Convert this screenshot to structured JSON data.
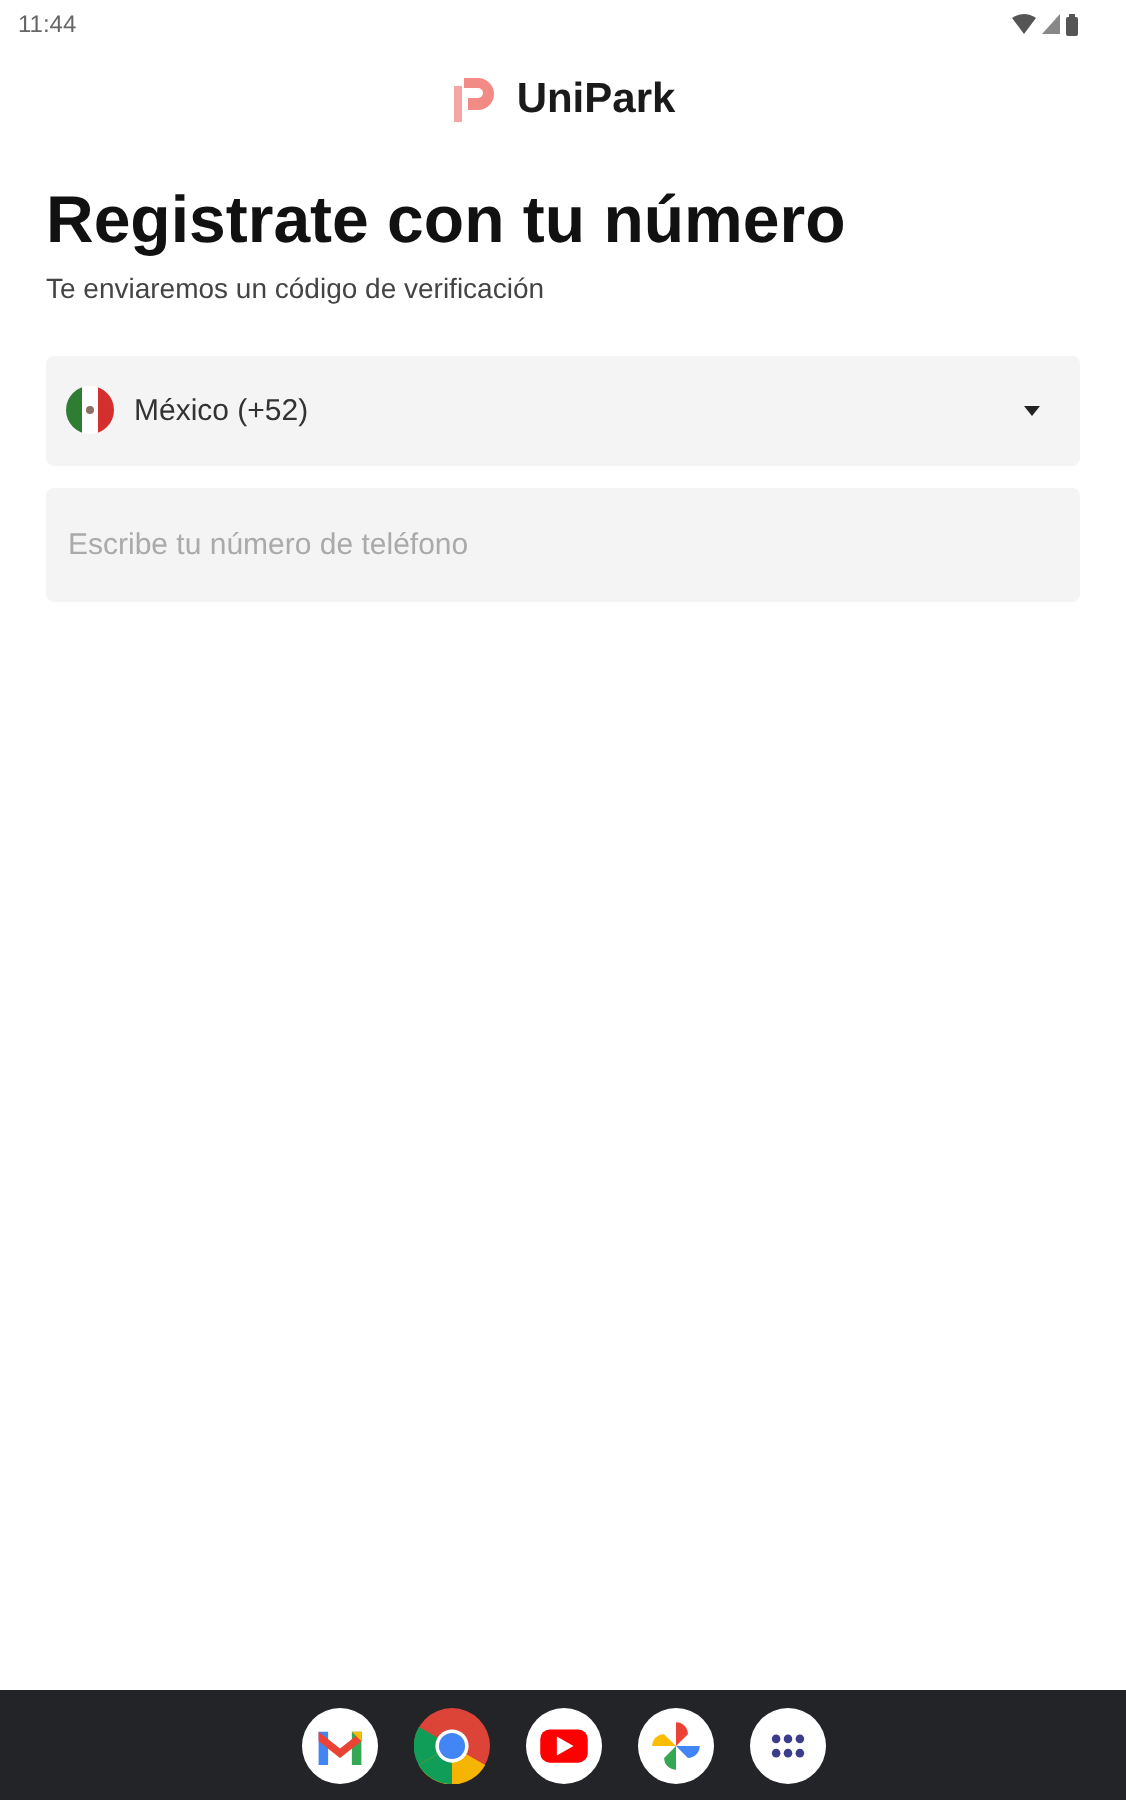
{
  "status_bar": {
    "time": "11:44"
  },
  "app": {
    "name": "UniPark"
  },
  "heading": "Registrate con tu número",
  "subheading": "Te enviaremos un código de verificación",
  "country_select": {
    "value": "México (+52)"
  },
  "phone_field": {
    "placeholder": "Escribe tu número de teléfono"
  },
  "taskbar": {
    "apps": [
      {
        "kind": "mail"
      },
      {
        "kind": "browser"
      },
      {
        "kind": "video"
      },
      {
        "kind": "pinwheel"
      },
      {
        "kind": "grid"
      }
    ]
  }
}
